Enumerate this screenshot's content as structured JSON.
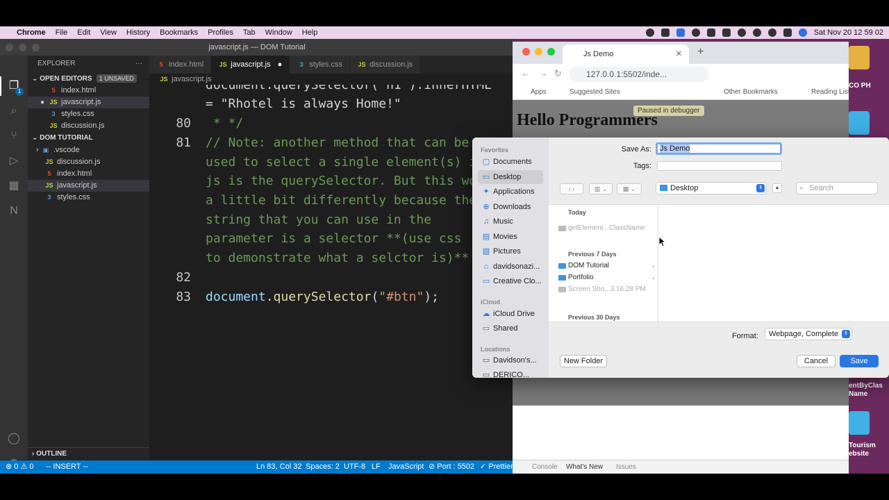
{
  "menubar": {
    "app": "Chrome",
    "items": [
      "File",
      "Edit",
      "View",
      "History",
      "Bookmarks",
      "Profiles",
      "Tab",
      "Window",
      "Help"
    ],
    "clock": "Sat Nov 20  12 59 02"
  },
  "vscode": {
    "window_title": "javascript.js — DOM Tutorial",
    "explorer_title": "EXPLORER",
    "open_editors": {
      "label": "OPEN EDITORS",
      "badge": "1 UNSAVED",
      "files": [
        "index.html",
        "javascript.js",
        "styles.css",
        "discussion.js"
      ]
    },
    "project": {
      "label": "DOM TUTORIAL",
      "items": [
        ".vscode",
        "discussion.js",
        "index.html",
        "javascript.js",
        "styles.css"
      ]
    },
    "outline_label": "OUTLINE",
    "tabs": [
      "index.html",
      "javascript.js",
      "styles.css",
      "discussion.js"
    ],
    "breadcrumb": "javascript.js",
    "activity_badge": "1",
    "code": {
      "line79": "document.querySelector(\"h1\").innerHTML",
      "line79b": "= \"Rhotel is always Home!\"",
      "n80": "80",
      "line80": " * */",
      "n81": "81",
      "line81": "// Note: another method that can be",
      "line81b": "used to select a single element(s) i",
      "line81c": "js is the querySelector. But this wo",
      "line81d": "a little bit differently because the",
      "line81e": "string that you can use in the",
      "line81f": "parameter is a selector **(use css",
      "line81g": "to demonstrate what a selctor is)**",
      "n82": "82",
      "n83": "83",
      "line83_obj": "document",
      "line83_fn": "querySelector",
      "line83_str": "\"#btn\"",
      "line83_end": ");"
    },
    "status": {
      "errors": "⊗ 0 ⚠ 0",
      "mode": "-- INSERT --",
      "position": "Ln 83, Col 32",
      "spaces": "Spaces: 2",
      "encoding": "UTF-8",
      "eol": "LF",
      "language": "JavaScript",
      "port": "⊘ Port : 5502",
      "prettier": "✓ Prettier"
    }
  },
  "chrome": {
    "tab_title": "Js Demo",
    "url": "127.0.0.1:5502/inde...",
    "bookmarks": [
      "Apps",
      "Suggested Sites",
      "Other Bookmarks",
      "Reading List"
    ],
    "paused": "Paused in debugger",
    "heading": "Hello Programmers",
    "devtools_tabs": [
      "Console",
      "What's New",
      "Issues"
    ]
  },
  "desktop": {
    "label1": "CO PH",
    "label2": "entByClas\nName",
    "label3": "Tourism\nebsite"
  },
  "dialog": {
    "favorites_label": "Favorites",
    "favorites": [
      "Documents",
      "Desktop",
      "Applications",
      "Downloads",
      "Music",
      "Movies",
      "Pictures",
      "davidsonazi...",
      "Creative Clo..."
    ],
    "icloud_label": "iCloud",
    "icloud": [
      "iCloud Drive",
      "Shared"
    ],
    "locations_label": "Locations",
    "locations": [
      "Davidson's...",
      "DERICO..."
    ],
    "save_as_label": "Save As:",
    "save_as_value": "Js Demo",
    "tags_label": "Tags:",
    "location": "Desktop",
    "search_placeholder": "Search",
    "today_label": "Today",
    "today_files": [
      "getElement...ClassName"
    ],
    "prev7_label": "Previous 7 Days",
    "prev7": [
      "DOM Tutorial",
      "Portfolio",
      "Screen Sho...3.16.28 PM"
    ],
    "prev30_label": "Previous 30 Days",
    "format_label": "Format:",
    "format_value": "Webpage, Complete",
    "new_folder": "New Folder",
    "cancel": "Cancel",
    "save": "Save"
  },
  "colors": {
    "accent": "#2b78e4",
    "vscode_status": "#007acc",
    "desktop_bg": "#6b2a5e"
  }
}
